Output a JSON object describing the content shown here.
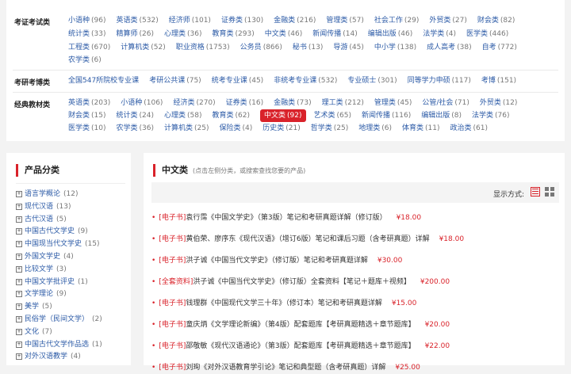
{
  "category_groups": [
    {
      "title": "考证考试类",
      "lines": [
        [
          {
            "label": "小语种",
            "count": "(96)"
          },
          {
            "label": "英语类",
            "count": "(532)"
          },
          {
            "label": "经济师",
            "count": "(101)"
          },
          {
            "label": "证券类",
            "count": "(130)"
          },
          {
            "label": "金融类",
            "count": "(216)"
          },
          {
            "label": "管理类",
            "count": "(57)"
          },
          {
            "label": "社会工作",
            "count": "(29)"
          },
          {
            "label": "外贸类",
            "count": "(27)"
          },
          {
            "label": "财会类",
            "count": "(82)"
          }
        ],
        [
          {
            "label": "统计类",
            "count": "(33)"
          },
          {
            "label": "精算师",
            "count": "(26)"
          },
          {
            "label": "心理类",
            "count": "(36)"
          },
          {
            "label": "教育类",
            "count": "(293)"
          },
          {
            "label": "中文类",
            "count": "(46)"
          },
          {
            "label": "新闻传播",
            "count": "(14)"
          },
          {
            "label": "编辑出版",
            "count": "(46)"
          },
          {
            "label": "法学类",
            "count": "(4)"
          },
          {
            "label": "医学类",
            "count": "(446)"
          }
        ],
        [
          {
            "label": "工程类",
            "count": "(670)"
          },
          {
            "label": "计算机类",
            "count": "(52)"
          },
          {
            "label": "职业资格",
            "count": "(1753)"
          },
          {
            "label": "公务员",
            "count": "(866)"
          },
          {
            "label": "秘书",
            "count": "(13)"
          },
          {
            "label": "导游",
            "count": "(45)"
          },
          {
            "label": "中小学",
            "count": "(138)"
          },
          {
            "label": "成人高考",
            "count": "(38)"
          },
          {
            "label": "自考",
            "count": "(772)"
          }
        ],
        [
          {
            "label": "农学类",
            "count": "(6)"
          }
        ]
      ]
    },
    {
      "title": "考研考博类",
      "lines": [
        [
          {
            "label": "全国547所院校专业课",
            "count": ""
          },
          {
            "label": "考研公共课",
            "count": "(75)"
          },
          {
            "label": "统考专业课",
            "count": "(45)"
          },
          {
            "label": "非统考专业课",
            "count": "(532)"
          },
          {
            "label": "专业硕士",
            "count": "(301)"
          },
          {
            "label": "同等学力申硕",
            "count": "(117)"
          },
          {
            "label": "考博",
            "count": "(151)"
          }
        ]
      ]
    },
    {
      "title": "经典教材类",
      "lines": [
        [
          {
            "label": "英语类",
            "count": "(203)"
          },
          {
            "label": "小语种",
            "count": "(106)"
          },
          {
            "label": "经济类",
            "count": "(270)"
          },
          {
            "label": "证券类",
            "count": "(16)"
          },
          {
            "label": "金融类",
            "count": "(73)"
          },
          {
            "label": "理工类",
            "count": "(212)"
          },
          {
            "label": "管理类",
            "count": "(45)"
          },
          {
            "label": "公管/社会",
            "count": "(71)"
          },
          {
            "label": "外贸类",
            "count": "(12)"
          }
        ],
        [
          {
            "label": "财会类",
            "count": "(15)"
          },
          {
            "label": "统计类",
            "count": "(24)"
          },
          {
            "label": "心理类",
            "count": "(58)"
          },
          {
            "label": "教育类",
            "count": "(62)"
          },
          {
            "label": "中文类",
            "count": "(92)",
            "active": true
          },
          {
            "label": "艺术类",
            "count": "(65)"
          },
          {
            "label": "新闻传播",
            "count": "(116)"
          },
          {
            "label": "编辑出版",
            "count": "(8)"
          },
          {
            "label": "法学类",
            "count": "(76)"
          }
        ],
        [
          {
            "label": "医学类",
            "count": "(10)"
          },
          {
            "label": "农学类",
            "count": "(36)"
          },
          {
            "label": "计算机类",
            "count": "(25)"
          },
          {
            "label": "保险类",
            "count": "(4)"
          },
          {
            "label": "历史类",
            "count": "(21)"
          },
          {
            "label": "哲学类",
            "count": "(25)"
          },
          {
            "label": "地理类",
            "count": "(6)"
          },
          {
            "label": "体育类",
            "count": "(11)"
          },
          {
            "label": "政治类",
            "count": "(61)"
          }
        ]
      ]
    }
  ],
  "sidebar": {
    "title": "产品分类",
    "plus_glyph": "+",
    "items": [
      {
        "label": "语言学概论",
        "count": "(12)"
      },
      {
        "label": "现代汉语",
        "count": "(13)"
      },
      {
        "label": "古代汉语",
        "count": "(5)"
      },
      {
        "label": "中国古代文学史",
        "count": "(9)"
      },
      {
        "label": "中国现当代文学史",
        "count": "(15)"
      },
      {
        "label": "外国文学史",
        "count": "(4)"
      },
      {
        "label": "比较文学",
        "count": "(3)"
      },
      {
        "label": "中国文学批评史",
        "count": "(1)"
      },
      {
        "label": "文学理论",
        "count": "(9)"
      },
      {
        "label": "美学",
        "count": "(5)"
      },
      {
        "label": "民俗学（民间文学）",
        "count": "(2)"
      },
      {
        "label": "文化",
        "count": "(7)"
      },
      {
        "label": "中国古代文学作品选",
        "count": "(1)"
      },
      {
        "label": "对外汉语教学",
        "count": "(4)"
      }
    ]
  },
  "main": {
    "title": "中文类",
    "hint": "(点击左侧分类，或搜索查找您要的产品)",
    "display_label": "显示方式:",
    "bullet_glyph": "•",
    "products": [
      {
        "tag": "[电子书]",
        "title": "袁行霈《中国文学史》（第3版）笔记和考研真题详解（修订版）",
        "price": "¥18.00"
      },
      {
        "tag": "[电子书]",
        "title": "黄伯荣、廖序东《现代汉语》（增订6版）笔记和课后习题（含考研真题）详解",
        "price": "¥18.00"
      },
      {
        "tag": "[电子书]",
        "title": "洪子诚《中国当代文学史》（修订版）笔记和考研真题详解",
        "price": "¥30.00"
      },
      {
        "tag": "[全套资料]",
        "title": "洪子诚《中国当代文学史》（修订版）全套资料【笔记＋题库＋视频】",
        "price": "¥200.00"
      },
      {
        "tag": "[电子书]",
        "title": "钱理群《中国现代文学三十年》（修订本）笔记和考研真题详解",
        "price": "¥15.00"
      },
      {
        "tag": "[电子书]",
        "title": "童庆炳《文学理论新编》（第4版）配套题库【考研真题精选＋章节题库】",
        "price": "¥20.00"
      },
      {
        "tag": "[电子书]",
        "title": "邵敬敏《现代汉语通论》（第3版）配套题库【考研真题精选＋章节题库】",
        "price": "¥22.00"
      },
      {
        "tag": "[电子书]",
        "title": "刘珣《对外汉语教育学引论》笔记和典型题（含考研真题）详解",
        "price": "¥25.00"
      }
    ]
  },
  "colors": {
    "accent": "#d9222a",
    "link": "#2b5aa6"
  }
}
